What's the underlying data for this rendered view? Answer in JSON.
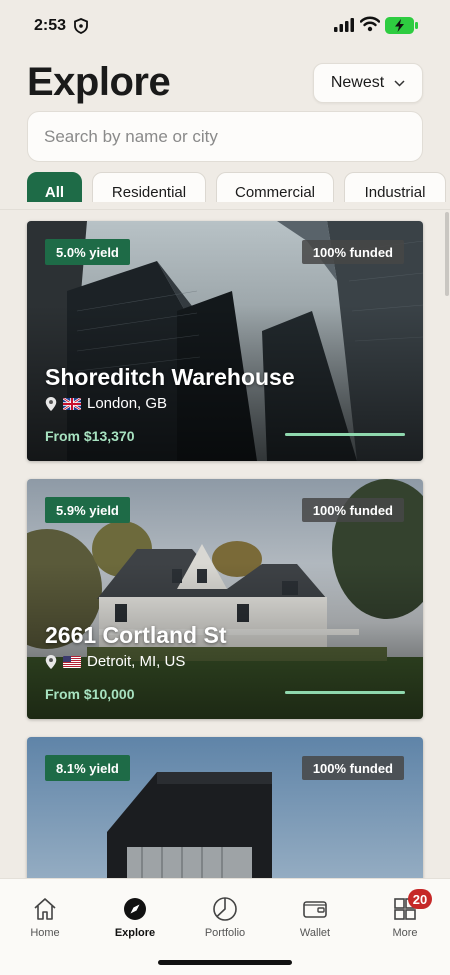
{
  "status_bar": {
    "time": "2:53"
  },
  "header": {
    "title": "Explore",
    "sort_label": "Newest"
  },
  "search": {
    "placeholder": "Search by name or city",
    "value": ""
  },
  "filters": [
    "All",
    "Residential",
    "Commercial",
    "Industrial"
  ],
  "listings": [
    {
      "yield": "5.0% yield",
      "funded": "100% funded",
      "funded_fraction": 1.0,
      "name": "Shoreditch Warehouse",
      "location": "London, GB",
      "flag": "gb-flag",
      "price": "From $13,370"
    },
    {
      "yield": "5.9% yield",
      "funded": "100% funded",
      "funded_fraction": 1.0,
      "name": "2661 Cortland St",
      "location": "Detroit, MI, US",
      "flag": "us-flag",
      "price": "From $10,000"
    },
    {
      "yield": "8.1% yield",
      "funded": "100% funded",
      "funded_fraction": 1.0
    }
  ],
  "tabs": [
    {
      "label": "Home",
      "icon": "home-icon"
    },
    {
      "label": "Explore",
      "icon": "compass-icon",
      "active": true
    },
    {
      "label": "Portfolio",
      "icon": "pie-chart-icon"
    },
    {
      "label": "Wallet",
      "icon": "wallet-icon"
    },
    {
      "label": "More",
      "icon": "grid-icon",
      "badge": "20"
    }
  ],
  "colors": {
    "accent": "#1e6b47",
    "background": "#efebe5",
    "badge": "#c62828",
    "price": "#a7e2c0"
  }
}
